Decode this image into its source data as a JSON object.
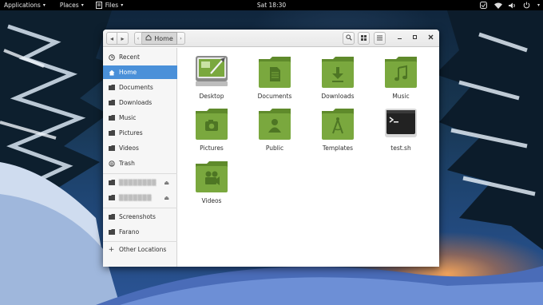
{
  "topbar": {
    "applications": "Applications",
    "places": "Places",
    "files": "Files",
    "clock": "Sat 18:30"
  },
  "window": {
    "path_label": "Home"
  },
  "sidebar": {
    "items": [
      {
        "label": "Recent",
        "icon": "clock-icon"
      },
      {
        "label": "Home",
        "icon": "home-icon",
        "active": true
      },
      {
        "label": "Documents",
        "icon": "folder-icon"
      },
      {
        "label": "Downloads",
        "icon": "folder-icon"
      },
      {
        "label": "Music",
        "icon": "folder-icon"
      },
      {
        "label": "Pictures",
        "icon": "folder-icon"
      },
      {
        "label": "Videos",
        "icon": "folder-icon"
      },
      {
        "label": "Trash",
        "icon": "trash-icon"
      }
    ],
    "devices": [
      {
        "label": "▒▒▒▒▒▒▒▒",
        "icon": "drive-icon"
      },
      {
        "label": "▒▒▒▒▒▒▒",
        "icon": "drive-icon"
      }
    ],
    "bookmarks": [
      {
        "label": "Screenshots",
        "icon": "folder-icon"
      },
      {
        "label": "Farano",
        "icon": "folder-icon"
      }
    ],
    "other_locations": "Other Locations"
  },
  "files": [
    {
      "name": "Desktop",
      "icon": "desktop-icon"
    },
    {
      "name": "Documents",
      "icon": "documents-folder-icon"
    },
    {
      "name": "Downloads",
      "icon": "downloads-folder-icon"
    },
    {
      "name": "Music",
      "icon": "music-folder-icon"
    },
    {
      "name": "Pictures",
      "icon": "pictures-folder-icon"
    },
    {
      "name": "Public",
      "icon": "public-folder-icon"
    },
    {
      "name": "Templates",
      "icon": "templates-folder-icon"
    },
    {
      "name": "test.sh",
      "icon": "terminal-script-icon"
    },
    {
      "name": "Videos",
      "icon": "videos-folder-icon"
    }
  ],
  "colors": {
    "folder_green": "#7aa83e",
    "selection_blue": "#4a90d9"
  }
}
